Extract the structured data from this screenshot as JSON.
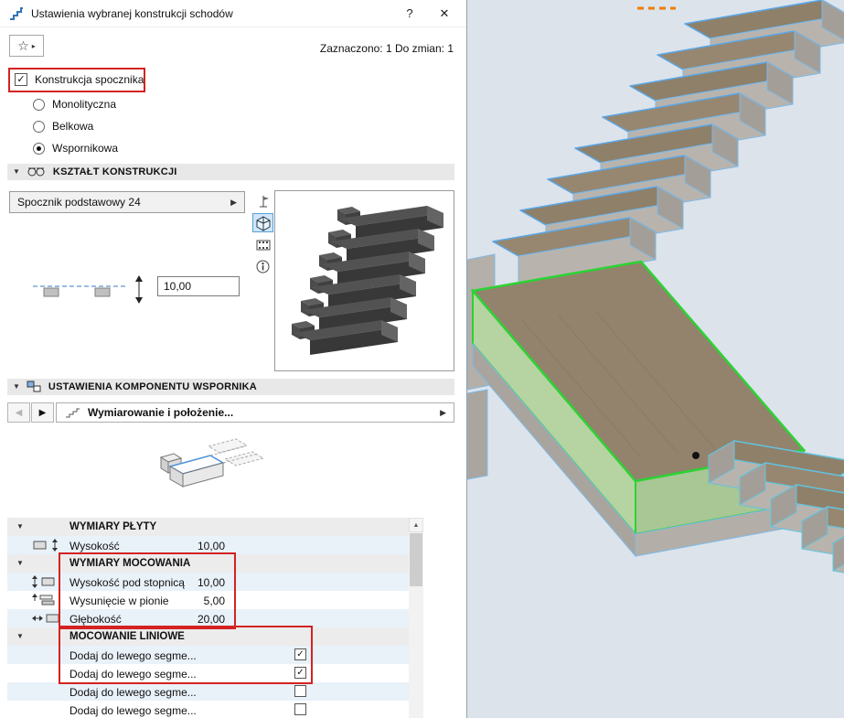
{
  "window": {
    "title": "Ustawienia wybranej konstrukcji schodów",
    "help_label": "?",
    "close_label": "✕",
    "selection_status": "Zaznaczono: 1 Do zmian: 1"
  },
  "glyphs": {
    "collapse": "▼",
    "menu_arrow": "▶",
    "nav_left": "◀",
    "nav_right": "▶",
    "scroll_up": "▲",
    "star": "☆",
    "star_menu": "▸",
    "check": "✓"
  },
  "landing_checkbox": {
    "label": "Konstrukcja spocznika",
    "checked": true
  },
  "structure_radios": [
    {
      "label": "Monolityczna",
      "selected": false
    },
    {
      "label": "Belkowa",
      "selected": false
    },
    {
      "label": "Wspornikowa",
      "selected": true
    }
  ],
  "shape_section": {
    "title": "KSZTAŁT KONSTRUKCJI",
    "dropdown_value": "Spocznik podstawowy 24",
    "height_value": "10,00"
  },
  "component_section": {
    "title": "USTAWIENIA KOMPONENTU WSPORNIKA",
    "nav_bar_label": "Wymiarowanie i położenie..."
  },
  "properties_table": {
    "groups": [
      {
        "title": "WYMIARY PŁYTY",
        "rows": [
          {
            "label": "Wysokość",
            "value": "10,00"
          }
        ]
      },
      {
        "title": "WYMIARY MOCOWANIA",
        "rows": [
          {
            "label": "Wysokość pod stopnicą",
            "value": "10,00"
          },
          {
            "label": "Wysunięcie w pionie",
            "value": "5,00"
          },
          {
            "label": "Głębokość",
            "value": "20,00"
          }
        ]
      },
      {
        "title": "MOCOWANIE LINIOWE",
        "rows": [
          {
            "label": "Dodaj do lewego segme...",
            "checked": true
          },
          {
            "label": "Dodaj do lewego segme...",
            "checked": true
          },
          {
            "label": "Dodaj do lewego segme...",
            "checked": false
          },
          {
            "label": "Dodaj do lewego segme...",
            "checked": false
          }
        ]
      }
    ]
  },
  "colors": {
    "selection_green": "#2bd333",
    "annotation_red": "#d42222",
    "edge_blue": "#5aa7e8",
    "edge_cyan": "#63c3e0",
    "viewport_bg": "#dce3ea"
  }
}
